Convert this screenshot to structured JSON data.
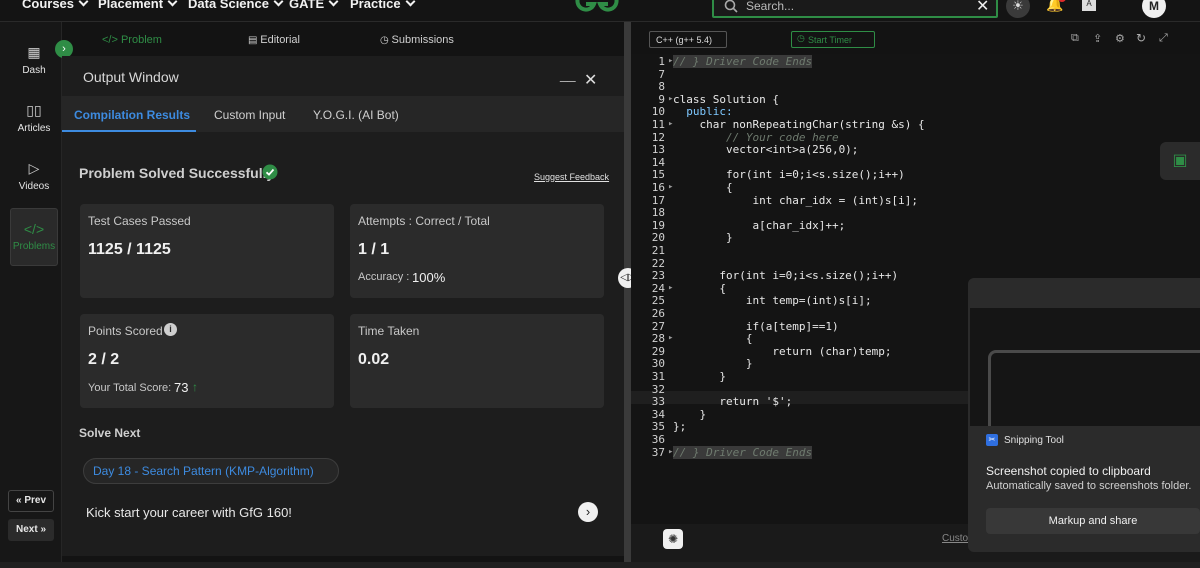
{
  "nav": {
    "items": [
      "Courses",
      "Placement",
      "Data Science",
      "GATE",
      "Practice"
    ],
    "search_placeholder": "Search...",
    "avatar_initial": "M"
  },
  "rail": {
    "items": [
      {
        "label": "Dash",
        "icon": "dashboard-icon"
      },
      {
        "label": "Articles",
        "icon": "book-icon"
      },
      {
        "label": "Videos",
        "icon": "play-icon"
      },
      {
        "label": "Problems",
        "icon": "code-icon"
      }
    ],
    "prev": "« Prev",
    "next": "Next »"
  },
  "panel_tabs": {
    "problem": "</> Problem",
    "editorial": "Editorial",
    "submissions": "Submissions"
  },
  "output": {
    "title": "Output Window",
    "tabs": [
      "Compilation Results",
      "Custom Input",
      "Y.O.G.I. (AI Bot)"
    ],
    "status": "Problem Solved Successfully",
    "suggest_feedback": "Suggest Feedback",
    "test_cases_label": "Test Cases Passed",
    "test_cases_value": "1125 / 1125",
    "attempts_label": "Attempts : Correct / Total",
    "attempts_value": "1 / 1",
    "accuracy_label": "Accuracy :",
    "accuracy_value": "100%",
    "points_label": "Points Scored",
    "points_value": "2 / 2",
    "total_score_label": "Your Total Score:",
    "total_score_value": "73",
    "time_label": "Time Taken",
    "time_value": "0.02",
    "solve_next": "Solve Next",
    "next_problem": "Day 18 - Search Pattern (KMP-Algorithm)",
    "promo": "Kick start your career with GfG 160!"
  },
  "editor": {
    "language": "C++ (g++ 5.4)",
    "start_timer": "Start Timer",
    "custom_label": "Custo",
    "lines": [
      {
        "n": "1",
        "fold": "▸",
        "code": "// } Driver Code Ends",
        "style": "cm"
      },
      {
        "n": "7",
        "fold": "",
        "code": "",
        "style": ""
      },
      {
        "n": "8",
        "fold": "",
        "code": "",
        "style": ""
      },
      {
        "n": "9",
        "fold": "▸",
        "code": "class Solution {",
        "style": ""
      },
      {
        "n": "10",
        "fold": "",
        "code": "  public:",
        "style": "kw"
      },
      {
        "n": "11",
        "fold": "▸",
        "code": "    char nonRepeatingChar(string &s) {",
        "style": ""
      },
      {
        "n": "12",
        "fold": "",
        "code": "        // Your code here",
        "style": "cm"
      },
      {
        "n": "13",
        "fold": "",
        "code": "        vector<int>a(256,0);",
        "style": ""
      },
      {
        "n": "14",
        "fold": "",
        "code": "",
        "style": ""
      },
      {
        "n": "15",
        "fold": "",
        "code": "        for(int i=0;i<s.size();i++)",
        "style": ""
      },
      {
        "n": "16",
        "fold": "▸",
        "code": "        {",
        "style": ""
      },
      {
        "n": "17",
        "fold": "",
        "code": "            int char_idx = (int)s[i];",
        "style": ""
      },
      {
        "n": "18",
        "fold": "",
        "code": "",
        "style": ""
      },
      {
        "n": "19",
        "fold": "",
        "code": "            a[char_idx]++;",
        "style": ""
      },
      {
        "n": "20",
        "fold": "",
        "code": "        }",
        "style": ""
      },
      {
        "n": "21",
        "fold": "",
        "code": "",
        "style": ""
      },
      {
        "n": "22",
        "fold": "",
        "code": "",
        "style": ""
      },
      {
        "n": "23",
        "fold": "",
        "code": "       for(int i=0;i<s.size();i++)",
        "style": ""
      },
      {
        "n": "24",
        "fold": "▸",
        "code": "       {",
        "style": ""
      },
      {
        "n": "25",
        "fold": "",
        "code": "           int temp=(int)s[i];",
        "style": ""
      },
      {
        "n": "26",
        "fold": "",
        "code": "",
        "style": ""
      },
      {
        "n": "27",
        "fold": "",
        "code": "           if(a[temp]==1)",
        "style": ""
      },
      {
        "n": "28",
        "fold": "▸",
        "code": "           {",
        "style": ""
      },
      {
        "n": "29",
        "fold": "",
        "code": "               return (char)temp;",
        "style": ""
      },
      {
        "n": "30",
        "fold": "",
        "code": "           }",
        "style": ""
      },
      {
        "n": "31",
        "fold": "",
        "code": "       }",
        "style": ""
      },
      {
        "n": "32",
        "fold": "",
        "code": "",
        "style": ""
      },
      {
        "n": "33",
        "fold": "",
        "code": "       return '$';",
        "style": ""
      },
      {
        "n": "34",
        "fold": "",
        "code": "    }",
        "style": ""
      },
      {
        "n": "35",
        "fold": "",
        "code": "};",
        "style": ""
      },
      {
        "n": "36",
        "fold": "",
        "code": "",
        "style": ""
      },
      {
        "n": "37",
        "fold": "▸",
        "code": "// } Driver Code Ends",
        "style": "cm"
      }
    ]
  },
  "snip": {
    "app": "Snipping Tool",
    "title": "Screenshot copied to clipboard",
    "subtitle": "Automatically saved to screenshots folder.",
    "button": "Markup and share"
  },
  "colors": {
    "accent": "#2f8d46",
    "link": "#1a73e8"
  }
}
